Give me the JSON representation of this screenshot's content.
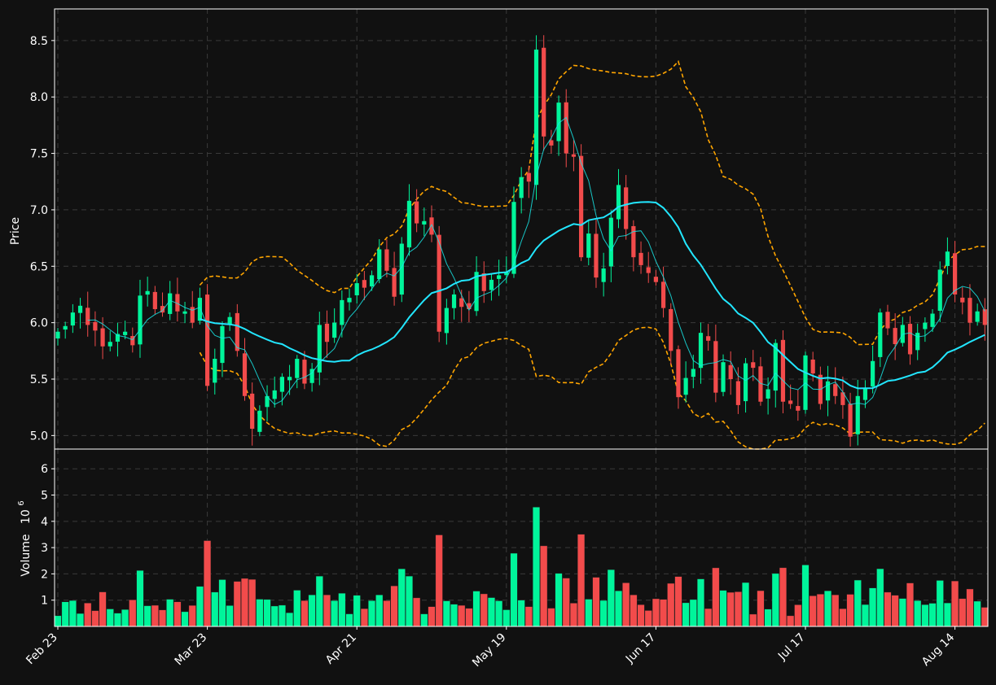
{
  "theme": {
    "background": "#111111",
    "panel_border": "#ffffff",
    "grid": "#3a3a3a",
    "up_color": "#00f59b",
    "down_color": "#f24b4b",
    "ma_fast_color": "#19e6e6",
    "ma_slow_color": "#22e6ff",
    "band_color": "#ffa500"
  },
  "chart_data": {
    "type": "candlestick",
    "title": "",
    "x_tick_labels": [
      "Feb 23",
      "Mar 23",
      "Apr 21",
      "May 19",
      "Jun 17",
      "Jul 17",
      "Aug 14"
    ],
    "x_tick_dates": [
      "Feb 23",
      "Mar 23",
      "Apr 21",
      "May 19",
      "Jun 17",
      "Jul 17",
      "Aug 14"
    ],
    "x_tick_index": [
      0,
      20,
      40,
      60,
      80,
      100,
      120
    ],
    "price_panel": {
      "ylabel": "Price",
      "ylim": [
        4.88,
        8.78
      ],
      "yticks": [
        5.0,
        5.5,
        6.0,
        6.5,
        7.0,
        7.5,
        8.0,
        8.5
      ]
    },
    "volume_panel": {
      "ylabel": "Volume",
      "ylabel_exponent": "10",
      "ylabel_power": "6",
      "ylim": [
        0,
        6.75
      ],
      "yticks": [
        1,
        2,
        3,
        4,
        5,
        6
      ]
    },
    "close": [
      5.92,
      5.97,
      6.09,
      6.15,
      5.98,
      5.93,
      5.79,
      5.83,
      5.9,
      5.92,
      5.8,
      6.24,
      6.28,
      6.12,
      6.09,
      6.26,
      6.1,
      6.1,
      6.0,
      6.22,
      5.44,
      5.68,
      5.97,
      6.05,
      5.75,
      5.35,
      5.06,
      5.22,
      5.35,
      5.4,
      5.52,
      5.52,
      5.68,
      5.46,
      5.59,
      5.98,
      5.83,
      6.0,
      6.2,
      6.22,
      6.35,
      6.31,
      6.42,
      6.65,
      6.46,
      6.23,
      6.7,
      7.08,
      6.88,
      6.9,
      6.78,
      5.92,
      6.13,
      6.25,
      6.14,
      6.12,
      6.45,
      6.28,
      6.38,
      6.42,
      6.45,
      7.07,
      7.29,
      7.25,
      8.42,
      7.65,
      7.57,
      7.95,
      7.5,
      7.47,
      6.58,
      6.79,
      6.4,
      6.48,
      6.93,
      7.22,
      6.83,
      6.58,
      6.51,
      6.44,
      6.36,
      6.13,
      5.75,
      5.34,
      5.51,
      5.59,
      5.91,
      5.84,
      5.38,
      5.65,
      5.5,
      5.27,
      5.64,
      5.6,
      5.3,
      5.41,
      5.82,
      5.3,
      5.28,
      5.22,
      5.71,
      5.55,
      5.28,
      5.48,
      5.35,
      5.27,
      4.99,
      5.35,
      5.42,
      5.66,
      6.09,
      5.95,
      5.81,
      5.98,
      5.72,
      5.91,
      6.0,
      6.08,
      6.47,
      6.63,
      6.25,
      6.18,
      6.0,
      6.1,
      5.98
    ]
  },
  "sma_params": {
    "fast": 5,
    "slow": 20,
    "bands": 20,
    "band_mult": 2.0
  }
}
